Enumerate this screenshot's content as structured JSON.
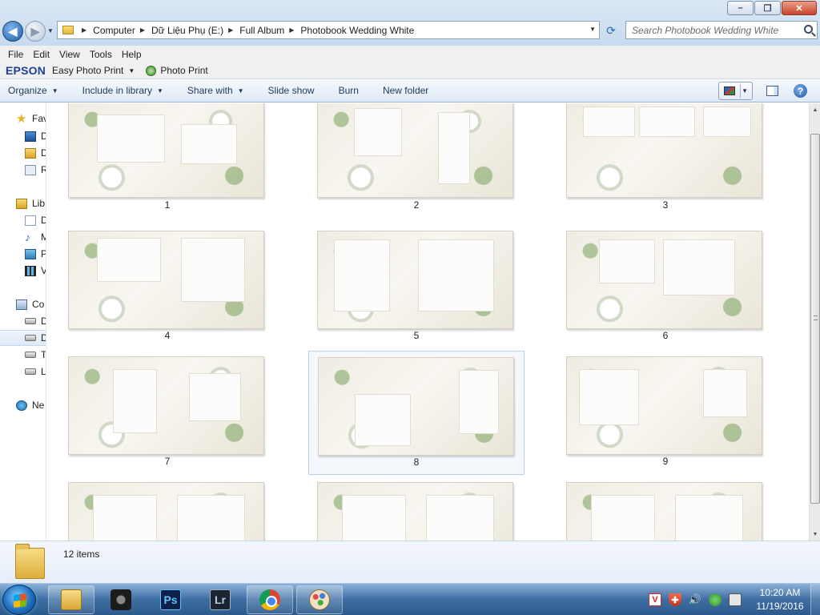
{
  "window": {
    "controls": {
      "minimize": "–",
      "maximize": "❐",
      "close": "✕"
    }
  },
  "address": {
    "crumbs": [
      "Computer",
      "Dữ Liệu Phụ (E:)",
      "Full Album",
      "Photobook Wedding White"
    ]
  },
  "search": {
    "placeholder": "Search Photobook Wedding White"
  },
  "menu": [
    "File",
    "Edit",
    "View",
    "Tools",
    "Help"
  ],
  "epson": {
    "logo": "EPSON",
    "easy_photo_print": "Easy Photo Print",
    "photo_print": "Photo Print"
  },
  "commands": {
    "organize": "Organize",
    "include_in_library": "Include in library",
    "share_with": "Share with",
    "slide_show": "Slide show",
    "burn": "Burn",
    "new_folder": "New folder"
  },
  "nav": {
    "favorites": "Fav",
    "desktop": "D",
    "downloads": "D",
    "recent": "R",
    "libraries": "Lib",
    "documents": "D",
    "music": "M",
    "pictures": "P",
    "videos": "V",
    "computer": "Co",
    "drive_c": "D",
    "drive_e": "D",
    "drive_t": "T",
    "drive_l": "L",
    "network": "Ne"
  },
  "items": [
    {
      "label": "1"
    },
    {
      "label": "2"
    },
    {
      "label": "3"
    },
    {
      "label": "4"
    },
    {
      "label": "5"
    },
    {
      "label": "6"
    },
    {
      "label": "7"
    },
    {
      "label": "8",
      "selected": true
    },
    {
      "label": "9"
    },
    {
      "label": ""
    },
    {
      "label": ""
    },
    {
      "label": ""
    }
  ],
  "details": {
    "item_count": "12 items"
  },
  "taskbar": {
    "apps": [
      {
        "name": "windows-explorer",
        "glyph": ""
      },
      {
        "name": "camera-app",
        "glyph": ""
      },
      {
        "name": "photoshop",
        "glyph": "Ps"
      },
      {
        "name": "lightroom",
        "glyph": "Lr"
      },
      {
        "name": "chrome",
        "glyph": ""
      },
      {
        "name": "paint",
        "glyph": ""
      }
    ],
    "tray": {
      "v": "V",
      "shield": "✚",
      "volume": "🔊"
    },
    "clock_time": "10:20 AM",
    "clock_date": "11/19/2016"
  }
}
